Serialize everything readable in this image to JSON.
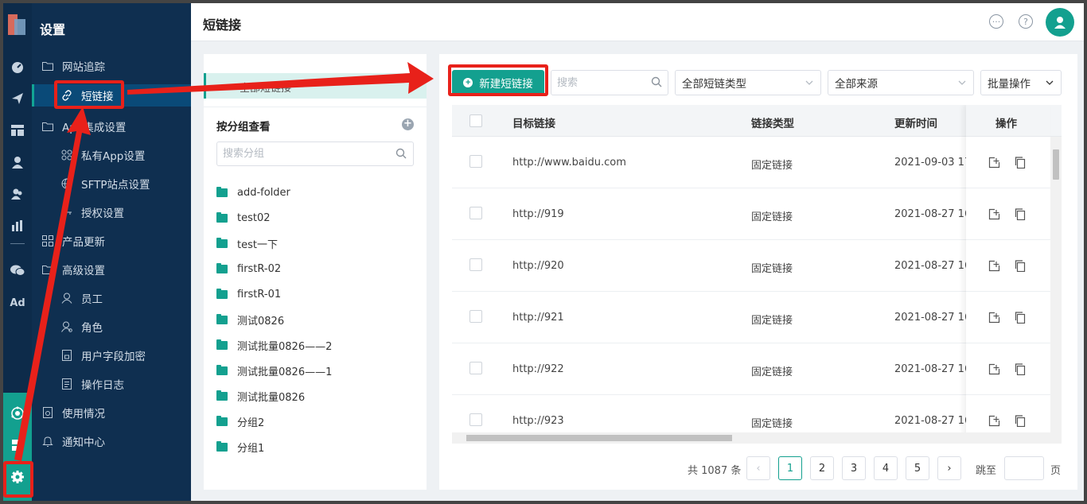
{
  "header": {
    "title": "短链接"
  },
  "sidebar": {
    "title": "设置",
    "items": [
      {
        "label": "网站追踪",
        "icon": "folder-icon"
      },
      {
        "label": "短链接",
        "icon": "link-icon",
        "active": true
      },
      {
        "label": "App集成设置",
        "icon": "folder-icon"
      },
      {
        "label": "私有App设置",
        "icon": "apps-icon"
      },
      {
        "label": "SFTP站点设置",
        "icon": "globe-icon"
      },
      {
        "label": "授权设置",
        "icon": "key-icon"
      },
      {
        "label": "产品更新",
        "icon": "grid-icon"
      },
      {
        "label": "高级设置",
        "icon": "folder-icon"
      },
      {
        "label": "员工",
        "icon": "user-icon"
      },
      {
        "label": "角色",
        "icon": "role-icon"
      },
      {
        "label": "用户字段加密",
        "icon": "lock-doc-icon"
      },
      {
        "label": "操作日志",
        "icon": "log-icon"
      },
      {
        "label": "使用情况",
        "icon": "usage-icon"
      },
      {
        "label": "通知中心",
        "icon": "bell-icon"
      }
    ]
  },
  "rail": {
    "ad_label": "Ad"
  },
  "groups": {
    "all_label": "全部短链接",
    "heading": "按分组查看",
    "search_placeholder": "搜索分组",
    "folders": [
      "add-folder",
      "test02",
      "test一下",
      "firstR-02",
      "firstR-01",
      "测试0826",
      "测试批量0826——2",
      "测试批量0826——1",
      "测试批量0826",
      "分组2",
      "分组1"
    ]
  },
  "toolbar": {
    "new_label": "新建短链接",
    "search_placeholder": "搜索",
    "type_filter": "全部短链类型",
    "source_filter": "全部来源",
    "batch_label": "批量操作"
  },
  "table": {
    "columns": {
      "target": "目标链接",
      "type": "链接类型",
      "updated": "更新时间",
      "ops": "操作"
    },
    "rows": [
      {
        "target": "http://www.baidu.com",
        "type": "固定链接",
        "updated": "2021-09-03 17"
      },
      {
        "target": "http://919",
        "type": "固定链接",
        "updated": "2021-08-27 16"
      },
      {
        "target": "http://920",
        "type": "固定链接",
        "updated": "2021-08-27 16"
      },
      {
        "target": "http://921",
        "type": "固定链接",
        "updated": "2021-08-27 16"
      },
      {
        "target": "http://922",
        "type": "固定链接",
        "updated": "2021-08-27 16"
      },
      {
        "target": "http://923",
        "type": "固定链接",
        "updated": "2021-08-27 16"
      }
    ]
  },
  "pagination": {
    "total": "共 1087 条",
    "pages": [
      "1",
      "2",
      "3",
      "4",
      "5"
    ],
    "current": "1",
    "jump_label": "跳至",
    "page_suffix": "页"
  },
  "colors": {
    "accent": "#13a08f",
    "sidebar": "#0f2f50",
    "annotation": "#e8211a"
  }
}
